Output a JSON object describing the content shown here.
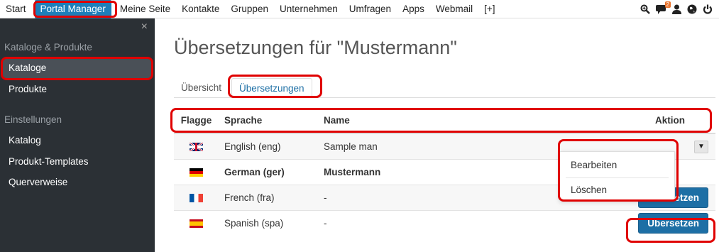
{
  "topnav": {
    "items": [
      "Start",
      "Portal Manager",
      "Meine Seite",
      "Kontakte",
      "Gruppen",
      "Unternehmen",
      "Umfragen",
      "Apps",
      "Webmail",
      "[+]"
    ],
    "active_index": 1,
    "notification_count": "2",
    "icons": [
      "zoom-icon",
      "chat-icon",
      "user-icon",
      "globe-icon",
      "power-icon"
    ]
  },
  "sidebar": {
    "close_glyph": "×",
    "section1": "Kataloge & Produkte",
    "items1": [
      "Kataloge",
      "Produkte"
    ],
    "section2": "Einstellungen",
    "items2": [
      "Katalog",
      "Produkt-Templates",
      "Querverweise"
    ],
    "active_item": "Kataloge"
  },
  "page": {
    "title": "Übersetzungen für \"Mustermann\""
  },
  "tabs": [
    "Übersicht",
    "Übersetzungen"
  ],
  "table": {
    "headers": [
      "Flagge",
      "Sprache",
      "Name",
      "Aktion"
    ],
    "rows": [
      {
        "flag": "uk-flag",
        "language": "English (eng)",
        "name": "Sample man",
        "action": ""
      },
      {
        "flag": "de-flag",
        "language": "German (ger)",
        "name": "Mustermann",
        "action": ""
      },
      {
        "flag": "fr-flag",
        "language": "French (fra)",
        "name": "-",
        "action": "Übersetzen"
      },
      {
        "flag": "es-flag",
        "language": "Spanish (spa)",
        "name": "-",
        "action": "Übersetzen"
      }
    ]
  },
  "dropdown": {
    "items": [
      "Bearbeiten",
      "Löschen"
    ]
  },
  "colors": {
    "accent": "#1d7fba",
    "sidebar_bg": "#2b3035",
    "highlight": "#e00000"
  }
}
